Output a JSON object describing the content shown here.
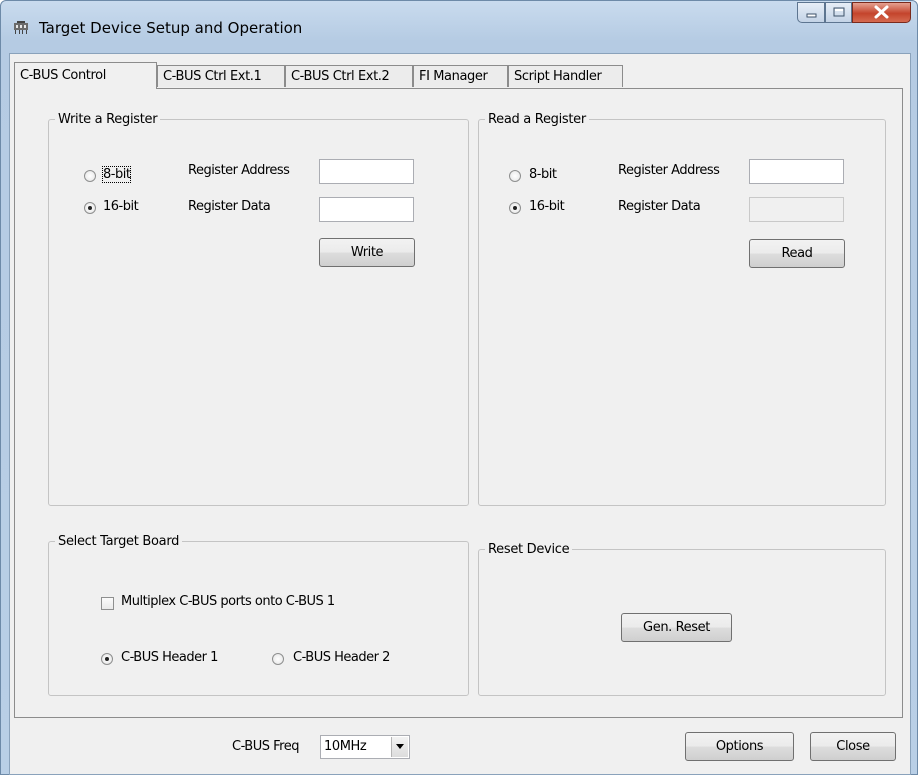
{
  "window": {
    "title": "Target Device Setup and Operation",
    "icon": "device-setup-icon"
  },
  "tabs": [
    {
      "label": "C-BUS Control",
      "active": true
    },
    {
      "label": "C-BUS Ctrl Ext.1",
      "active": false
    },
    {
      "label": "C-BUS Ctrl Ext.2",
      "active": false
    },
    {
      "label": "FI Manager",
      "active": false
    },
    {
      "label": "Script Handler",
      "active": false
    }
  ],
  "write_register": {
    "legend": "Write a Register",
    "radio_8bit": "8-bit",
    "radio_16bit": "16-bit",
    "selected_width": "16-bit",
    "address_label": "Register Address",
    "address_value": "",
    "data_label": "Register Data",
    "data_value": "",
    "button": "Write"
  },
  "read_register": {
    "legend": "Read a Register",
    "radio_8bit": "8-bit",
    "radio_16bit": "16-bit",
    "selected_width": "16-bit",
    "address_label": "Register Address",
    "address_value": "",
    "data_label": "Register Data",
    "data_value": "",
    "button": "Read"
  },
  "target_board": {
    "legend": "Select Target Board",
    "multiplex_label": "Multiplex C-BUS ports onto C-BUS 1",
    "multiplex_checked": false,
    "header1": "C-BUS Header 1",
    "header2": "C-BUS Header 2",
    "selected_header": "C-BUS Header 1"
  },
  "reset_device": {
    "legend": "Reset Device",
    "button": "Gen. Reset"
  },
  "footer": {
    "freq_label": "C-BUS Freq",
    "freq_value": "10MHz",
    "options_button": "Options",
    "close_button": "Close"
  },
  "colors": {
    "title_bar": "#b9cfe6",
    "client_bg": "#f0f0f0",
    "close_button": "#c4442c"
  }
}
